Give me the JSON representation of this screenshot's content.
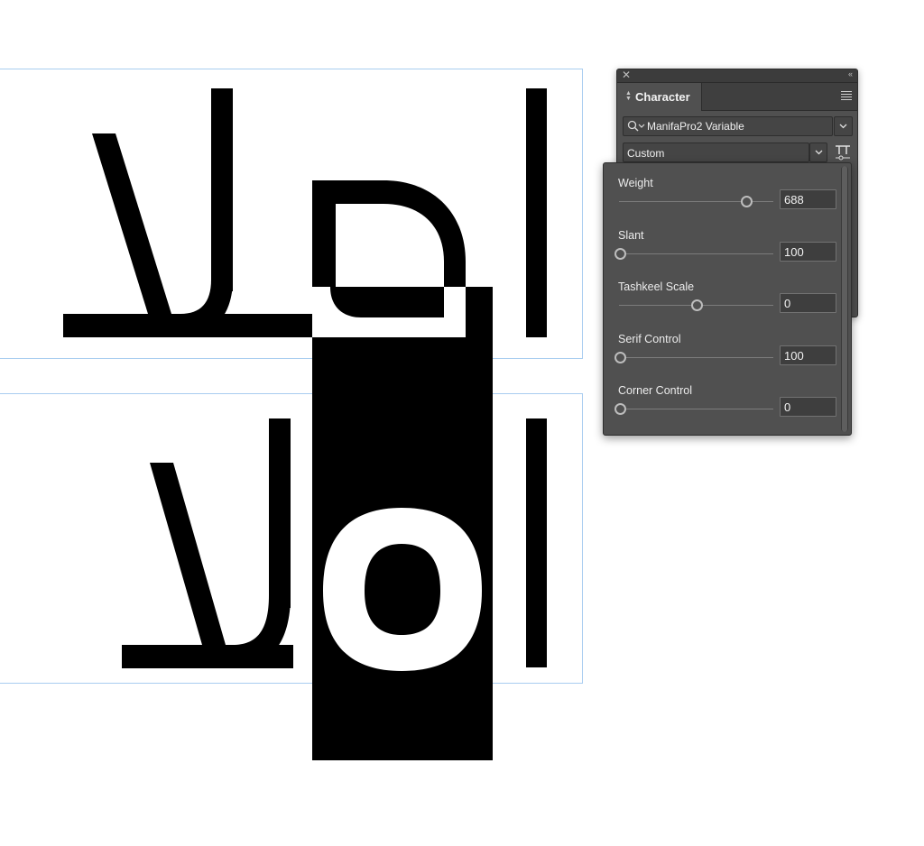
{
  "canvas": {
    "text_frame_top": "اهلا",
    "text_frame_bottom": "اهلا"
  },
  "panel": {
    "title": "Character",
    "font_family": "ManifaPro2 Variable",
    "font_style": "Custom",
    "icons": [
      "close-icon",
      "collapse-icon",
      "panel-menu-icon",
      "search-icon",
      "chevron-down-icon",
      "variable-font-icon"
    ]
  },
  "axes": [
    {
      "label": "Weight",
      "value": "688",
      "level": 0.82
    },
    {
      "label": "Slant",
      "value": "100",
      "level": 0.0
    },
    {
      "label": "Tashkeel Scale",
      "value": "0",
      "level": 0.5
    },
    {
      "label": "Serif Control",
      "value": "100",
      "level": 0.0
    },
    {
      "label": "Corner Control",
      "value": "0",
      "level": 0.0
    }
  ]
}
